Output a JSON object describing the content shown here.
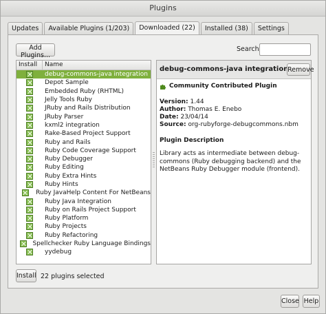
{
  "window": {
    "title": "Plugins"
  },
  "tabs": [
    {
      "label": "Updates",
      "active": false
    },
    {
      "label": "Available Plugins (1/203)",
      "active": false
    },
    {
      "label": "Downloaded (22)",
      "active": true
    },
    {
      "label": "Installed (38)",
      "active": false
    },
    {
      "label": "Settings",
      "active": false
    }
  ],
  "toolbar": {
    "add_plugins_label": "Add Plugins...",
    "search_label": "Search:",
    "search_value": ""
  },
  "list": {
    "columns": {
      "install": "Install",
      "name": "Name"
    },
    "selected_index": 0,
    "rows": [
      "debug-commons-java integration",
      "Depot Sample",
      "Embedded Ruby (RHTML)",
      "Jelly Tools Ruby",
      "JRuby and Rails Distribution",
      "JRuby Parser",
      "kxml2 integration",
      "Rake-Based Project Support",
      "Ruby and Rails",
      "Ruby Code Coverage Support",
      "Ruby Debugger",
      "Ruby Editing",
      "Ruby Extra Hints",
      "Ruby Hints",
      "Ruby JavaHelp Content For NetBeans",
      "Ruby Java Integration",
      "Ruby on Rails Project Support",
      "Ruby Platform",
      "Ruby Projects",
      "Ruby Refactoring",
      "Spellchecker Ruby Language Bindings",
      "yydebug"
    ]
  },
  "detail": {
    "title": "debug-commons-java integration",
    "remove_label": "Remove",
    "community_label": "Community Contributed Plugin",
    "version_label": "Version:",
    "version": "1.44",
    "author_label": "Author:",
    "author": "Thomas E. Enebo",
    "date_label": "Date:",
    "date": "23/04/14",
    "source_label": "Source:",
    "source": "org-rubyforge-debugcommons.nbm",
    "description_title": "Plugin Description",
    "description": "Library acts as intermediate between debug-commons (Ruby debugging backend) and the NetBeans Ruby Debugger module (frontend)."
  },
  "footer": {
    "install_label": "Install",
    "status": "22 plugins selected"
  },
  "bottom": {
    "close_label": "Close",
    "help_label": "Help"
  },
  "colors": {
    "selection": "#7fb03d",
    "checkbox": "#89c053",
    "icon_green": "#4f8a1e"
  },
  "icons": {
    "community": "puzzle-icon",
    "checkbox": "checkbox-checked-icon"
  }
}
